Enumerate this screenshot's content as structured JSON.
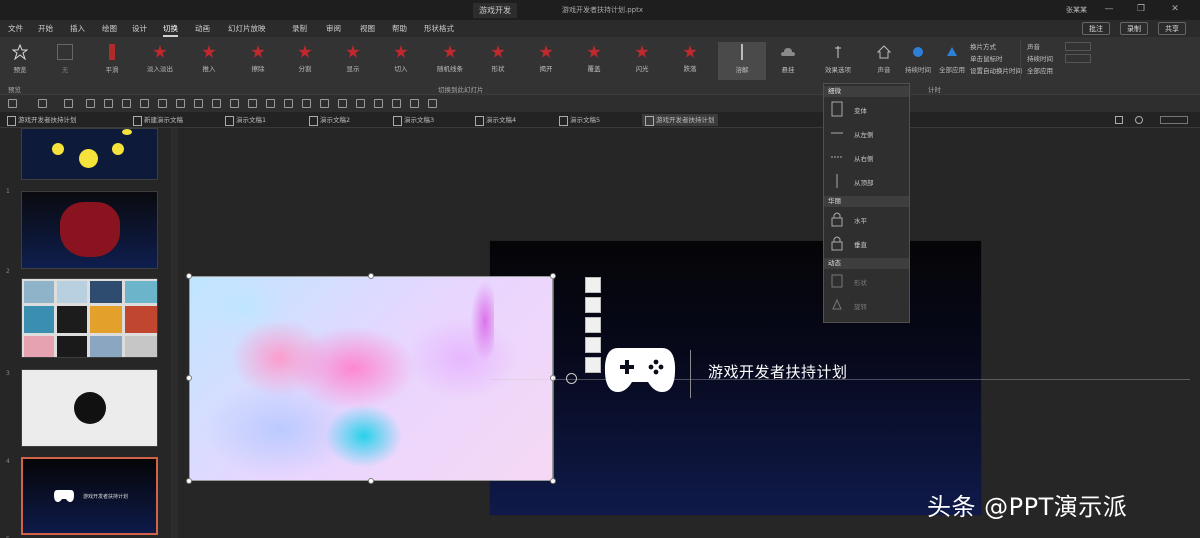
{
  "window": {
    "doc_title": "游戏开发",
    "app_title": "游戏开发者扶持计划.pptx",
    "user_name": "张某某",
    "minimize_glyph": "—",
    "restore_glyph": "❐",
    "close_glyph": "✕"
  },
  "tabs": {
    "items": [
      "文件",
      "开始",
      "插入",
      "绘图",
      "设计",
      "切换",
      "动画",
      "幻灯片放映",
      "录制",
      "审阅",
      "视图",
      "帮助",
      "形状格式"
    ],
    "active_index": 5,
    "share_label": "共享",
    "comments_label": "批注",
    "record_label": "录制"
  },
  "ribbon": {
    "preview_label": "预览",
    "transitions": [
      "无",
      "平滑",
      "淡入淡出",
      "推入",
      "擦除",
      "分割",
      "显示",
      "切入",
      "随机线条",
      "形状",
      "揭开",
      "覆盖",
      "闪光",
      "跌落",
      "悬挂"
    ],
    "highlight_label": "溶解",
    "effects_label": "效果选项",
    "options": [
      "声音",
      "持续时间",
      "全部应用"
    ],
    "advance": [
      "换片方式",
      "单击鼠标时",
      "设置自动换片时间"
    ]
  },
  "groups": {
    "preview": "预览",
    "transition_to_slide": "切换到此幻灯片",
    "timing": "计时"
  },
  "doc_tabs": [
    "游戏开发者扶持计划",
    "新建演示文稿",
    "演示文稿1",
    "演示文稿2",
    "演示文稿3",
    "演示文稿4",
    "演示文稿5",
    "游戏开发者扶持计划"
  ],
  "thumbnails": {
    "numbers": [
      "1",
      "2",
      "3",
      "4",
      "5"
    ]
  },
  "slide": {
    "title": "游戏开发者扶持计划",
    "thumb_title": "游戏开发者扶持计划"
  },
  "dropdown": {
    "section_1": "细微",
    "section_2": "华丽",
    "section_3": "动态",
    "items": [
      "变体",
      "从左侧",
      "从右侧",
      "从顶部",
      "水平",
      "垂直",
      "形状",
      "旋转"
    ]
  },
  "watermark": "头条 @PPT演示派"
}
